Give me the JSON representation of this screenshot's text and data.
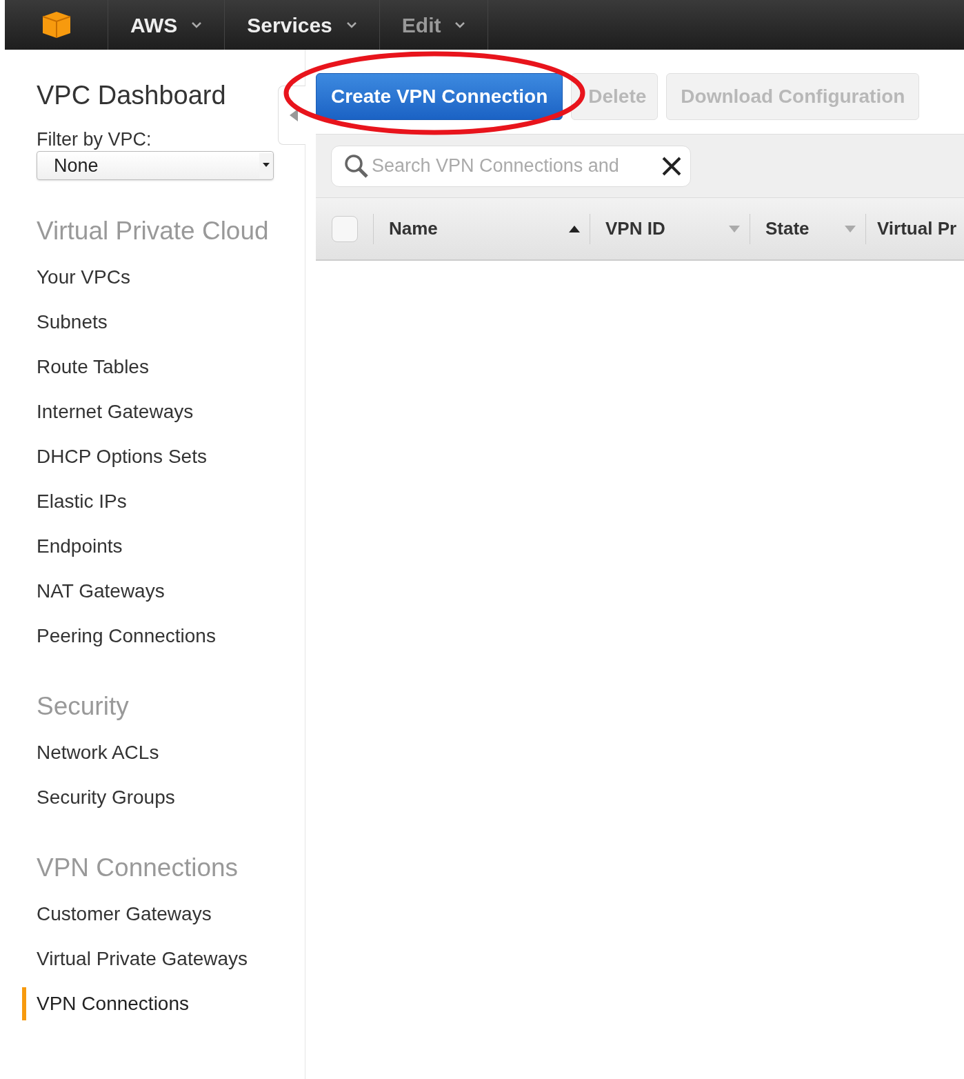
{
  "top_bar": {
    "menus": [
      {
        "label": "AWS",
        "disabled": false
      },
      {
        "label": "Services",
        "disabled": false
      },
      {
        "label": "Edit",
        "disabled": true
      }
    ]
  },
  "sidebar": {
    "title": "VPC Dashboard",
    "filter": {
      "label": "Filter by VPC:",
      "value": "None"
    },
    "sections": [
      {
        "heading": "Virtual Private Cloud",
        "items": [
          {
            "label": "Your VPCs",
            "selected": false
          },
          {
            "label": "Subnets",
            "selected": false
          },
          {
            "label": "Route Tables",
            "selected": false
          },
          {
            "label": "Internet Gateways",
            "selected": false
          },
          {
            "label": "DHCP Options Sets",
            "selected": false
          },
          {
            "label": "Elastic IPs",
            "selected": false
          },
          {
            "label": "Endpoints",
            "selected": false
          },
          {
            "label": "NAT Gateways",
            "selected": false
          },
          {
            "label": "Peering Connections",
            "selected": false
          }
        ]
      },
      {
        "heading": "Security",
        "items": [
          {
            "label": "Network ACLs",
            "selected": false
          },
          {
            "label": "Security Groups",
            "selected": false
          }
        ]
      },
      {
        "heading": "VPN Connections",
        "items": [
          {
            "label": "Customer Gateways",
            "selected": false
          },
          {
            "label": "Virtual Private Gateways",
            "selected": false
          },
          {
            "label": "VPN Connections",
            "selected": true
          }
        ]
      }
    ]
  },
  "toolbar": {
    "buttons": [
      {
        "label": "Create VPN Connection",
        "disabled": false
      },
      {
        "label": "Delete",
        "disabled": true
      },
      {
        "label": "Download Configuration",
        "disabled": true
      }
    ]
  },
  "search": {
    "placeholder": "Search VPN Connections and"
  },
  "table": {
    "select_all": {
      "checked": false
    },
    "columns": [
      {
        "label": "Name",
        "sorted": true
      },
      {
        "label": "VPN ID",
        "sorted": false
      },
      {
        "label": "State",
        "sorted": false
      },
      {
        "label": "Virtual Pr"
      }
    ]
  }
}
